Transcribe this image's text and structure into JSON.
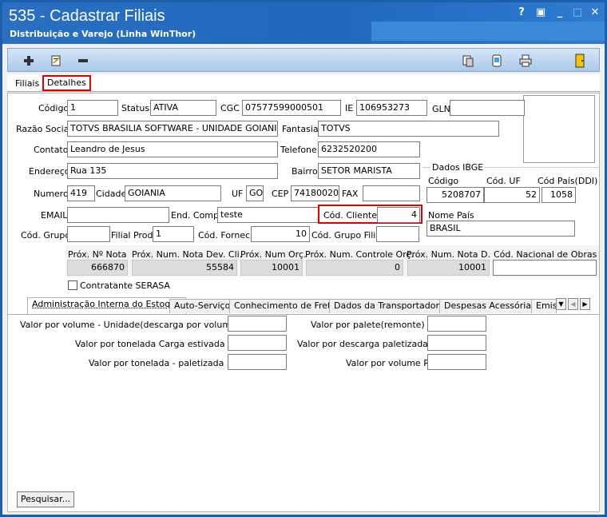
{
  "window": {
    "title": "535 - Cadastrar Filiais",
    "subtitle": "Distribuição e Varejo (Linha WinThor)",
    "controls": [
      "?",
      "▣",
      "_",
      "□",
      "✕"
    ]
  },
  "toolbar": {
    "icons": [
      "add-icon",
      "edit-icon",
      "remove-icon",
      "copy-icon",
      "report-icon",
      "print-icon",
      "exit-icon"
    ]
  },
  "tabs_top": [
    {
      "label": "Filiais",
      "selected": false
    },
    {
      "label": "Detalhes",
      "selected": true
    }
  ],
  "form": {
    "codigo": {
      "label": "Código",
      "value": "1"
    },
    "status": {
      "label": "Status",
      "value": "ATIVA"
    },
    "cgc": {
      "label": "CGC",
      "value": "07577599000501"
    },
    "ie": {
      "label": "IE",
      "value": "106953273"
    },
    "gln": {
      "label": "GLN",
      "value": ""
    },
    "razao_social": {
      "label": "Razão Social",
      "value": "TOTVS BRASILIA SOFTWARE - UNIDADE GOIANI"
    },
    "fantasia": {
      "label": "Fantasia",
      "value": "TOTVS"
    },
    "contato": {
      "label": "Contato",
      "value": "Leandro de Jesus"
    },
    "telefone": {
      "label": "Telefone",
      "value": "6232520200"
    },
    "endereco": {
      "label": "Endereço",
      "value": "Rua 135"
    },
    "bairro": {
      "label": "Bairro",
      "value": "SETOR MARISTA"
    },
    "numero": {
      "label": "Numero",
      "value": "419"
    },
    "cidade": {
      "label": "Cidade",
      "value": "GOIANIA"
    },
    "uf": {
      "label": "UF",
      "value": "GO"
    },
    "cep": {
      "label": "CEP",
      "value": "74180020"
    },
    "fax": {
      "label": "FAX",
      "value": ""
    },
    "email": {
      "label": "EMAIL",
      "value": ""
    },
    "end_comp": {
      "label": "End. Comp.",
      "value": "teste"
    },
    "cod_cliente": {
      "label": "Cód. Cliente",
      "value": "4"
    },
    "cod_grupo": {
      "label": "Cód. Grupo",
      "value": ""
    },
    "filial_prod": {
      "label": "Filial Prod.",
      "value": "1"
    },
    "cod_fornec": {
      "label": "Cód. Fornec.",
      "value": "10"
    },
    "cod_grupo_filial": {
      "label": "Cód. Grupo Filial",
      "value": ""
    }
  },
  "ibge": {
    "group_label": "Dados IBGE",
    "codigo_label": "Código",
    "codigo": "5208707",
    "cod_uf_label": "Cód. UF",
    "cod_uf": "52",
    "cod_pais_label": "Cód País(DDI)",
    "cod_pais": "1058",
    "nome_pais_label": "Nome País",
    "nome_pais": "BRASIL"
  },
  "next_numbers": {
    "prox_nota": {
      "label": "Próx. Nº Nota",
      "value": "666870"
    },
    "prox_nota_dev": {
      "label": "Próx. Num. Nota Dev. Cli.",
      "value": "55584"
    },
    "prox_orc": {
      "label": "Próx. Num Orç.",
      "value": "10001"
    },
    "prox_controle_orc": {
      "label": "Próx. Num. Controle Orç.",
      "value": "0"
    },
    "prox_nota_d": {
      "label": "Próx. Num. Nota D.",
      "value": "10001"
    },
    "cod_nacional_obras": {
      "label": "Cód. Nacional de Obras",
      "value": ""
    }
  },
  "serasa": {
    "label": "Contratante SERASA",
    "checked": false
  },
  "bottom_tabs": [
    "Administração Interna do Estoque",
    "Auto-Serviço",
    "Conhecimento de Frete",
    "Dados da Transportadora",
    "Despesas Acessórias",
    "Emiss"
  ],
  "estoque": {
    "valor_volume_unidade": {
      "label": "Valor por volume - Unidade(descarga por volume)R$:",
      "value": ""
    },
    "valor_tonelada_estivada": {
      "label": "Valor por tonelada Carga estivada R$:",
      "value": ""
    },
    "valor_tonelada_paletizada": {
      "label": "Valor por tonelada - paletizada R$:",
      "value": ""
    },
    "valor_palete": {
      "label": "Valor por palete(remonte) R$:",
      "value": ""
    },
    "valor_descarga_paletizada": {
      "label": "Valor por descarga paletizada R$:",
      "value": ""
    },
    "valor_volume": {
      "label": "Valor por volume R$:",
      "value": ""
    }
  },
  "pesquisar_label": "Pesquisar..."
}
